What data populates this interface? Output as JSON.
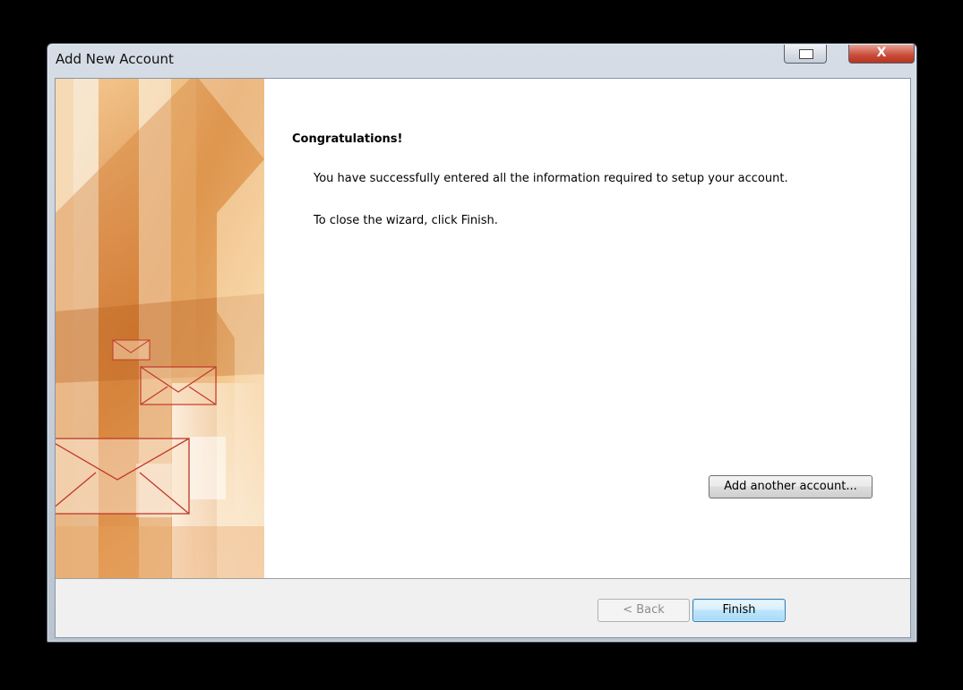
{
  "window": {
    "title": "Add New Account",
    "restore_icon": "restore-icon",
    "close_icon": "close-icon",
    "close_glyph": "X"
  },
  "content": {
    "heading": "Congratulations!",
    "message1": "You have successfully entered all the information required to setup your account.",
    "message2": "To close the wizard, click Finish.",
    "add_account_label": "Add another account..."
  },
  "footer": {
    "back_label": "< Back",
    "finish_label": "Finish"
  },
  "colors": {
    "accent": "#d9852e",
    "envelope_line": "#c0392b"
  }
}
